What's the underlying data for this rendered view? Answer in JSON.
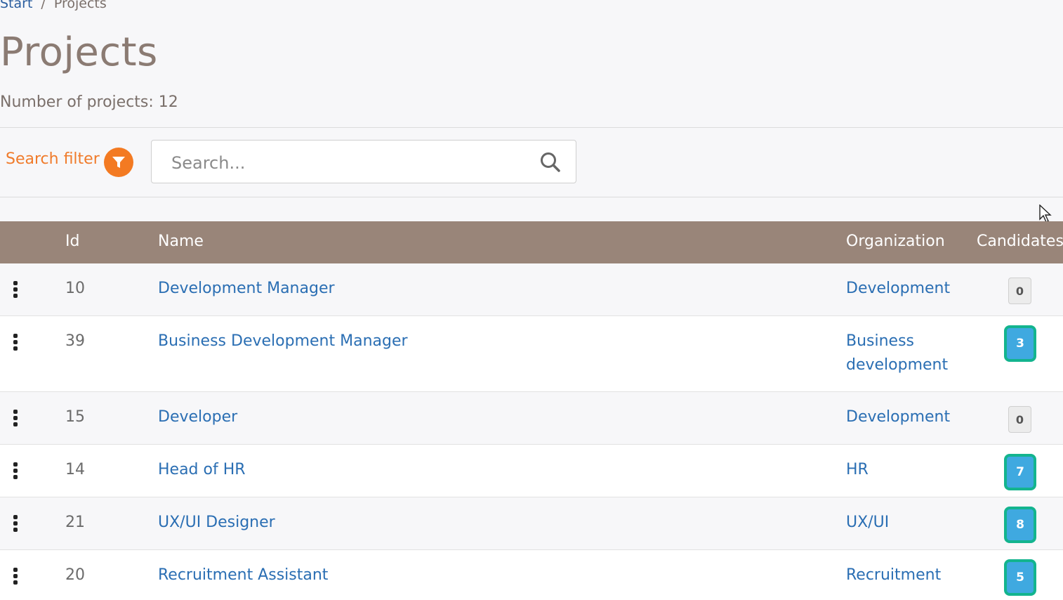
{
  "breadcrumb": {
    "start": "Start",
    "separator": "/",
    "current": "Projects"
  },
  "page": {
    "title": "Projects",
    "count_label": "Number of projects: 12"
  },
  "filter": {
    "label": "Search filter",
    "icon": "filter-icon",
    "color": "#f37a22"
  },
  "search": {
    "placeholder": "Search...",
    "value": "",
    "icon": "search-icon"
  },
  "table": {
    "header_color": "#998579",
    "columns": {
      "id": "Id",
      "name": "Name",
      "organization": "Organization",
      "candidates": "Candidates"
    },
    "rows": [
      {
        "id": "10",
        "name": "Development Manager",
        "organization": "Development",
        "candidates": "0"
      },
      {
        "id": "39",
        "name": "Business Development Manager",
        "organization": "Business development",
        "candidates": "3"
      },
      {
        "id": "15",
        "name": "Developer",
        "organization": "Development",
        "candidates": "0"
      },
      {
        "id": "14",
        "name": "Head of HR",
        "organization": "HR",
        "candidates": "7"
      },
      {
        "id": "21",
        "name": "UX/UI Designer",
        "organization": "UX/UI",
        "candidates": "8"
      },
      {
        "id": "20",
        "name": "Recruitment Assistant",
        "organization": "Recruitment",
        "candidates": "5"
      }
    ]
  }
}
